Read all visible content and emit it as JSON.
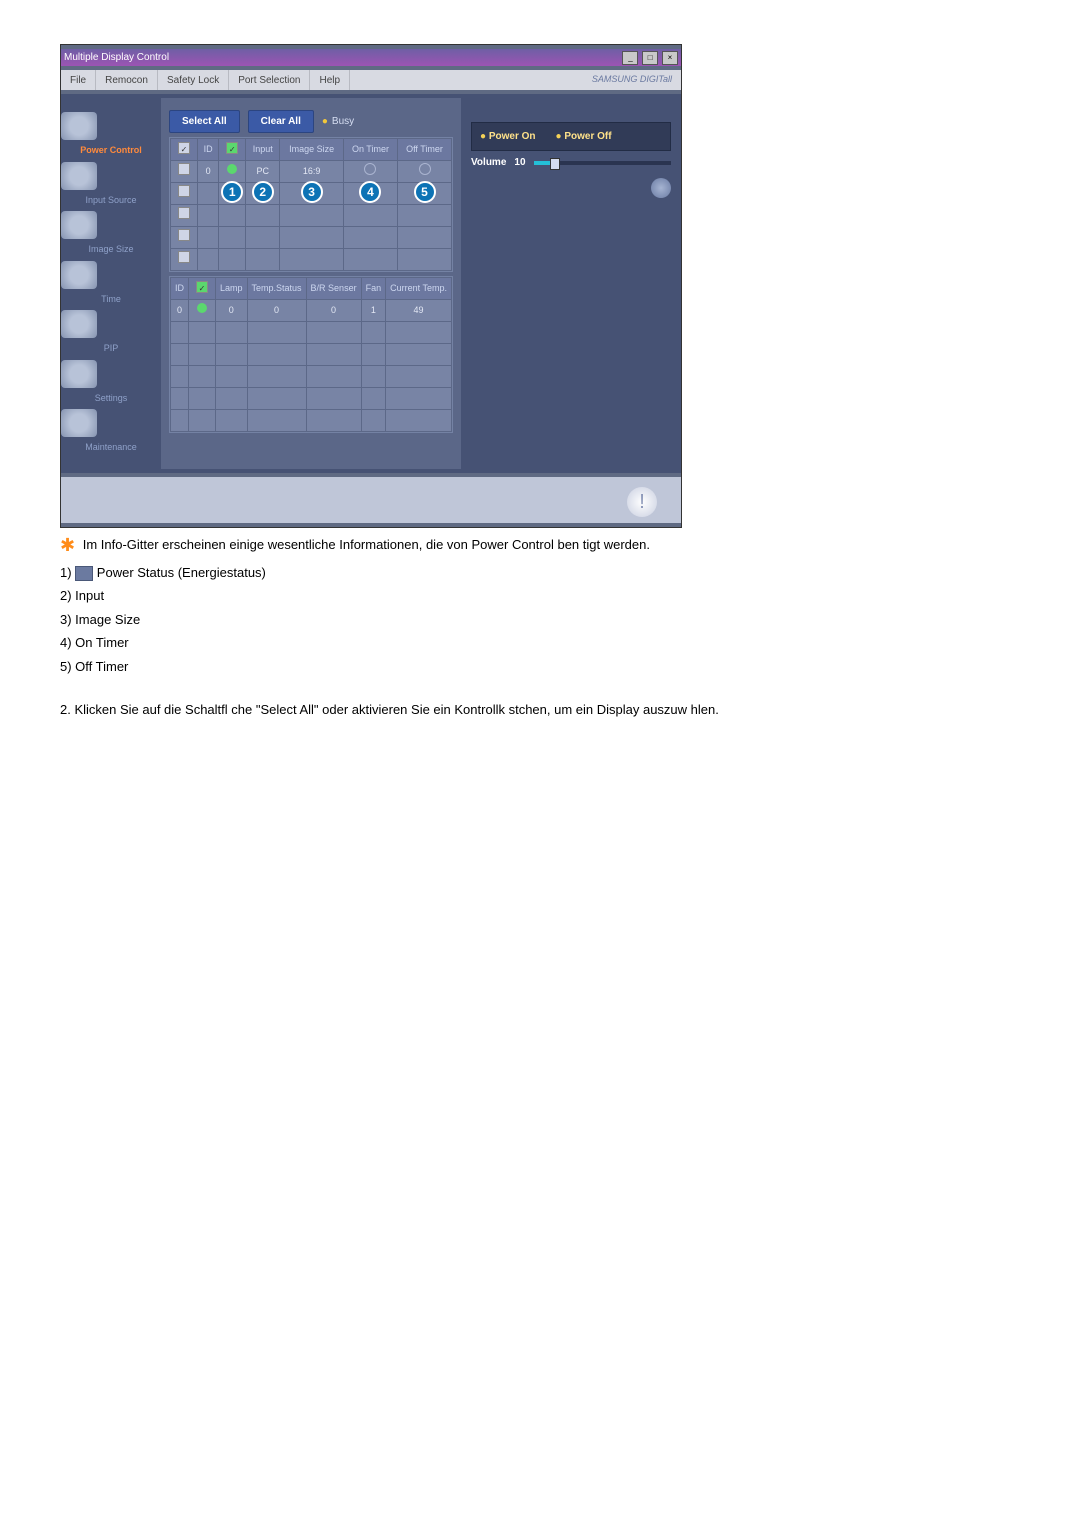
{
  "window": {
    "title": "Multiple Display Control"
  },
  "menu": [
    "File",
    "Remocon",
    "Safety Lock",
    "Port Selection",
    "Help"
  ],
  "brand": "SAMSUNG DIGITall",
  "sidebar": [
    {
      "label": "Power Control",
      "active": true
    },
    {
      "label": "Input Source",
      "active": false
    },
    {
      "label": "Image Size",
      "active": false
    },
    {
      "label": "Time",
      "active": false
    },
    {
      "label": "PIP",
      "active": false
    },
    {
      "label": "Settings",
      "active": false
    },
    {
      "label": "Maintenance",
      "active": false
    }
  ],
  "toolbar": {
    "select_all": "Select All",
    "clear_all": "Clear All",
    "busy": "Busy"
  },
  "grid1": {
    "headers": [
      "",
      "ID",
      "",
      "Input",
      "Image Size",
      "On Timer",
      "Off Timer"
    ],
    "row0": {
      "id": "0",
      "input": "PC",
      "size": "16:9"
    }
  },
  "grid2": {
    "headers": [
      "ID",
      "",
      "Lamp",
      "Temp.Status",
      "B/R Senser",
      "Fan",
      "Current Temp."
    ],
    "row0": {
      "id": "0",
      "lamp": "0",
      "temp": "0",
      "br": "0",
      "fan": "1",
      "ct": "49"
    }
  },
  "callouts": [
    "1",
    "2",
    "3",
    "4",
    "5"
  ],
  "power": {
    "on": "Power On",
    "off": "Power Off"
  },
  "volume": {
    "label": "Volume",
    "value": "10"
  },
  "doc": {
    "intro": "Im Info-Gitter erscheinen einige wesentliche Informationen, die von Power Control ben tigt werden.",
    "items": [
      "Power Status (Energiestatus)",
      "Input",
      "Image Size",
      "On Timer",
      "Off Timer"
    ],
    "second": "2.  Klicken Sie auf die Schaltfl che \"Select All\" oder aktivieren Sie ein Kontrollk stchen, um ein Display auszuw hlen."
  }
}
